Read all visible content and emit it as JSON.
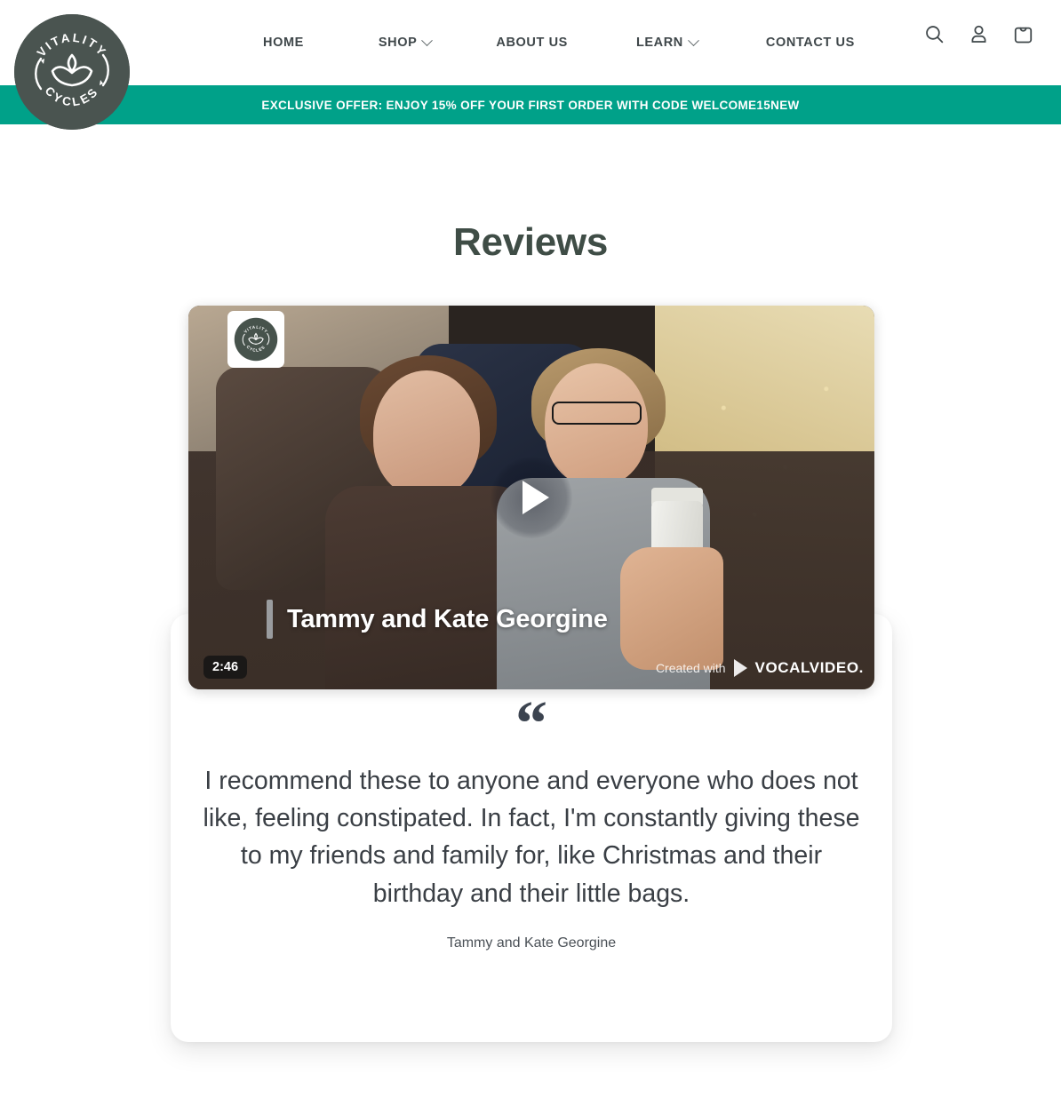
{
  "header": {
    "logo": {
      "top_text": "VITALITY",
      "bottom_text": "CYCLES",
      "icon": "lotus-cycle-logo",
      "color": "#4A5450"
    },
    "nav": [
      {
        "label": "HOME",
        "has_dropdown": false
      },
      {
        "label": "SHOP",
        "has_dropdown": true
      },
      {
        "label": "ABOUT US",
        "has_dropdown": false
      },
      {
        "label": "LEARN",
        "has_dropdown": true
      },
      {
        "label": "CONTACT US",
        "has_dropdown": false
      }
    ],
    "icons": [
      {
        "name": "search-icon"
      },
      {
        "name": "account-icon"
      },
      {
        "name": "cart-icon"
      }
    ]
  },
  "promo_banner": {
    "text": "EXCLUSIVE OFFER: ENJOY 15% OFF YOUR FIRST ORDER WITH CODE WELCOME15NEW",
    "background": "#00A189",
    "text_color": "#FFFFFF"
  },
  "page": {
    "title": "Reviews",
    "title_color": "#3F4D46"
  },
  "review": {
    "video": {
      "duration": "2:46",
      "caption_name": "Tammy and Kate Georgine",
      "play_label": "play-video",
      "watermark_logo": "vitality-cycles-logo",
      "branding": {
        "prefix": "Created with",
        "wordmark": "VOCALVIDEO."
      }
    },
    "quote_mark": "“",
    "quote": "I recommend these to anyone and everyone who does not like, feeling constipated. In fact, I'm constantly giving these to my friends and family for, like Christmas and their birthday and their little bags.",
    "author": "Tammy and Kate Georgine"
  }
}
